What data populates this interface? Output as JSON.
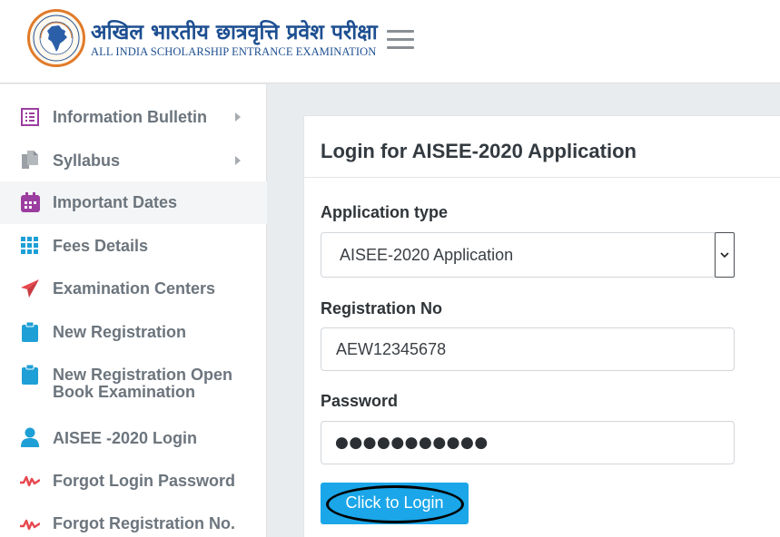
{
  "header": {
    "title_hindi": "अखिल भारतीय छात्रवृत्ति प्रवेश परीक्षा",
    "title_english": "ALL INDIA SCHOLARSHIP ENTRANCE EXAMINATION",
    "logo_icon": "india-map-seal-icon",
    "menu_icon": "hamburger-menu-icon"
  },
  "sidebar": {
    "items": [
      {
        "label": "Information Bulletin",
        "icon": "list-icon",
        "has_submenu": true
      },
      {
        "label": "Syllabus",
        "icon": "documents-icon",
        "has_submenu": true
      },
      {
        "label": "Important Dates",
        "icon": "calendar-icon",
        "active": true
      },
      {
        "label": "Fees Details",
        "icon": "grid-icon"
      },
      {
        "label": "Examination Centers",
        "icon": "paper-plane-icon"
      },
      {
        "label": "New Registration",
        "icon": "clipboard-icon"
      },
      {
        "label": "New Registration Open",
        "label_line2": "Book Examination",
        "icon": "clipboard-icon"
      },
      {
        "label": "AISEE -2020 Login",
        "icon": "user-icon"
      },
      {
        "label": "Forgot Login Password",
        "icon": "pulse-icon"
      },
      {
        "label": "Forgot Registration No.",
        "icon": "pulse-icon"
      }
    ]
  },
  "login": {
    "title": "Login for AISEE-2020 Application",
    "application_type_label": "Application type",
    "application_type_value": "AISEE-2020 Application",
    "registration_label": "Registration No",
    "registration_value": "AEW12345678",
    "password_label": "Password",
    "password_masked": "●●●●●●●●●●●",
    "submit_label": "Click to Login"
  },
  "colors": {
    "brand_blue": "#1d4f91",
    "button_blue": "#1aa6e8",
    "icon_purple": "#9b3ea0",
    "icon_red": "#e8484f",
    "icon_cyan": "#1e9fd6"
  }
}
